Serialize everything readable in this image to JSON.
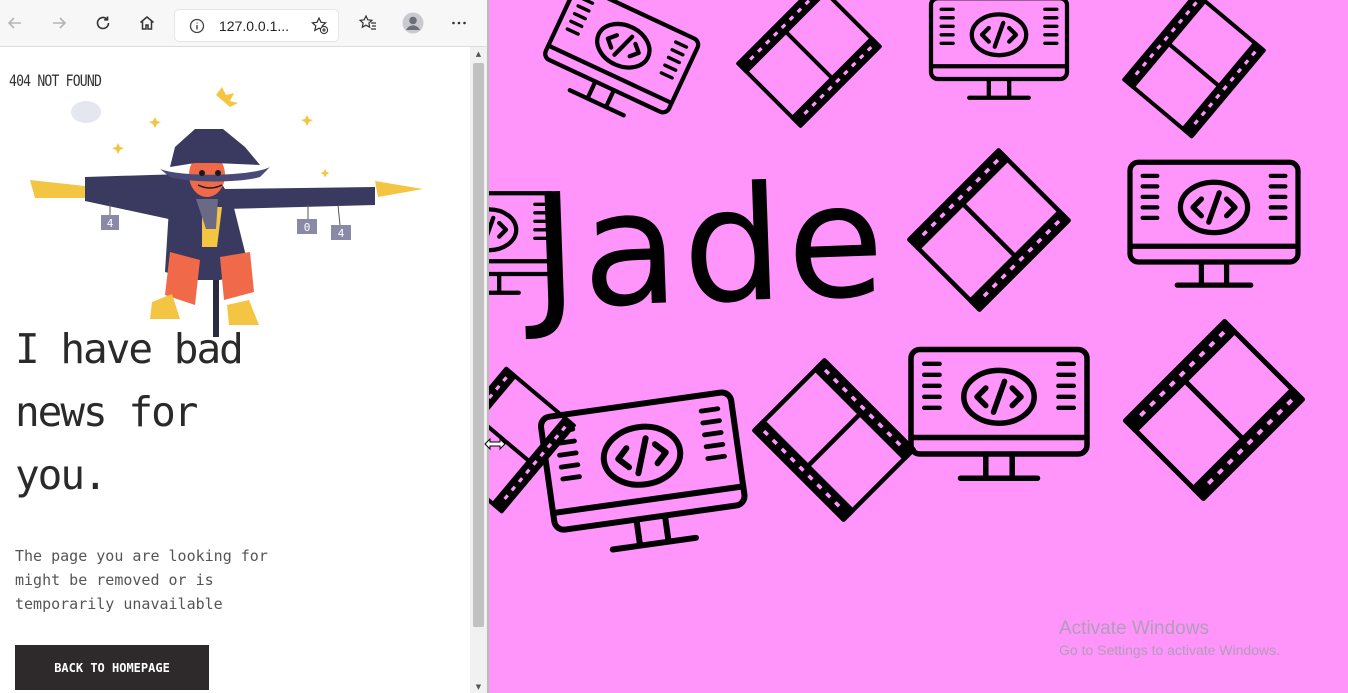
{
  "browser": {
    "address": {
      "text": "127.0.0.1..."
    }
  },
  "page": {
    "not_found_label": "404 NOT FOUND",
    "headline_lines": [
      "I have bad",
      "news for",
      "you."
    ],
    "description_lines": [
      "The page you are looking for",
      "might be removed or is",
      "temporarily unavailable"
    ],
    "back_button": "BACK TO HOMEPAGE",
    "scarecrow_tags": [
      "4",
      "0",
      "4"
    ]
  },
  "desktop": {
    "wallpaper_text": "Jade",
    "background": "#ff94fb",
    "watermark": {
      "title": "Activate Windows",
      "subtitle": "Go to Settings to activate Windows."
    }
  }
}
